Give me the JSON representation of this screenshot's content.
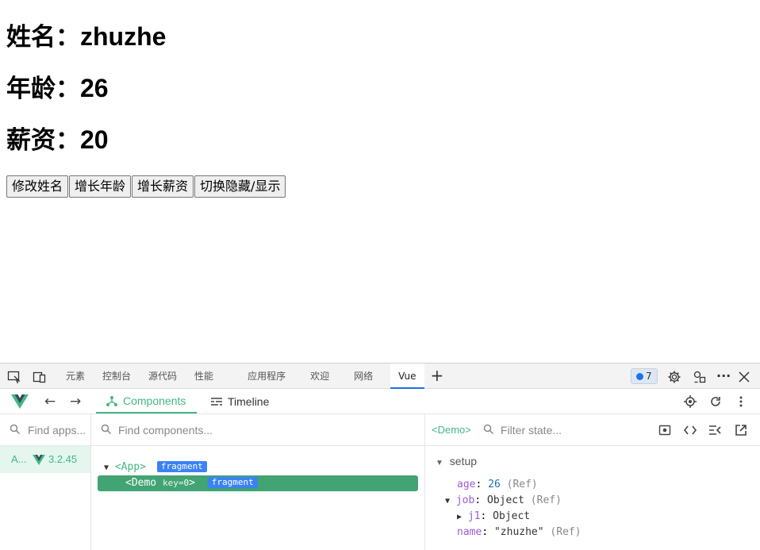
{
  "page": {
    "name_label": "姓名：",
    "name_value": "zhuzhe",
    "age_label": "年龄：",
    "age_value": "26",
    "salary_label": "薪资：",
    "salary_value": "20",
    "buttons": [
      "修改姓名",
      "增长年龄",
      "增长薪资",
      "切换隐藏/显示"
    ]
  },
  "devtools": {
    "tabs": [
      "元素",
      "控制台",
      "源代码",
      "性能",
      "应用程序",
      "欢迎",
      "网络",
      "Vue"
    ],
    "active_tab": "Vue",
    "issues_count": "7",
    "vue": {
      "tabs": [
        {
          "label": "Components",
          "active": true
        },
        {
          "label": "Timeline",
          "active": false
        }
      ],
      "apps_search_placeholder": "Find apps...",
      "components_search_placeholder": "Find components...",
      "state_filter_placeholder": "Filter state...",
      "selected_component": "<Demo>",
      "app_item": {
        "name": "A...",
        "version": "3.2.45"
      },
      "tree": [
        {
          "name": "<App>",
          "tag": "fragment"
        },
        {
          "name": "<Demo",
          "key_label": "key",
          "key_value": "0",
          "close": ">",
          "tag": "fragment",
          "selected": true
        }
      ],
      "state": {
        "section": "setup",
        "rows": [
          {
            "key": "age",
            "value": "26",
            "note": "(Ref)"
          },
          {
            "key": "job",
            "value": "Object",
            "note": "(Ref)",
            "expanded": true
          },
          {
            "key": "j1",
            "value": "Object",
            "note": "",
            "collapsed": true
          },
          {
            "key": "name",
            "value": "\"zhuzhe\"",
            "note": "(Ref)"
          }
        ]
      }
    }
  },
  "colors": {
    "vue_green": "#42b883",
    "selected_bg": "#42a373",
    "fragment_tag": "#3b82f6",
    "active_tab_underline": "#1a73e8"
  }
}
